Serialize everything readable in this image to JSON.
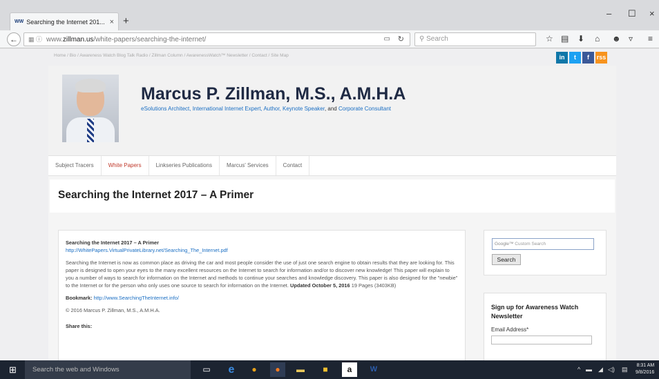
{
  "browser": {
    "tab_favicon": "WW",
    "tab_title": "Searching the Internet 201...",
    "tab_close": "×",
    "new_tab": "+",
    "url_prefix": "www.",
    "url_domain": "zillman.us",
    "url_path": "/white-papers/searching-the-internet/",
    "search_placeholder": "Search",
    "window_controls": {
      "minimize": "–",
      "maximize": "☐",
      "close": "×"
    },
    "toolbar_icons": [
      "star-icon",
      "clipboard-icon",
      "download-icon",
      "home-icon",
      "chat-icon",
      "pocket-icon",
      "menu-icon"
    ]
  },
  "site": {
    "topnav": "Home / Bio / Awareness Watch Blog Talk Radio / Zillman Column / AwarenessWatch™ Newsletter / Contact / Site Map",
    "social": [
      {
        "label": "in",
        "color": "#0e76a8"
      },
      {
        "label": "t",
        "color": "#1da1f2"
      },
      {
        "label": "f",
        "color": "#3b5998"
      },
      {
        "label": "rss",
        "color": "#f7931e"
      }
    ],
    "name": "Marcus P. Zillman, M.S., A.M.H.A",
    "tagline": {
      "part1": "eSolutions Architect, International Internet Expert, Author, ",
      "link1": "Keynote Speaker",
      "part2": ", and ",
      "link2": "Corporate Consultant"
    },
    "menu": [
      {
        "label": "Subject Tracers",
        "active": false
      },
      {
        "label": "White Papers",
        "active": true
      },
      {
        "label": "Linkseries Publications",
        "active": false
      },
      {
        "label": "Marcus' Services",
        "active": false
      },
      {
        "label": "Contact",
        "active": false
      }
    ]
  },
  "article": {
    "page_title": "Searching the Internet 2017 – A Primer",
    "title": "Searching the Internet 2017 – A Primer",
    "url": "http://WhitePapers.VirtualPrivateLibrary.net/Searching_The_Internet.pdf",
    "body": "Searching the Internet is now as common place as driving the car and most people consider the use of just one search engine to obtain results that they are looking for. This paper is designed to open your eyes to the many excellent resources on the Internet to search for information and/or to discover new knowledge! This paper will explain to you a number of ways to search for information on the Internet and methods to continue your searches and knowledge discovery. This paper is also designed for the \"newbie\" to the Internet or for the person who only uses one source to search for information on the Internet.",
    "updated": "Updated October 5, 2016",
    "pages": "19 Pages (3403KB)",
    "bookmark_label": "Bookmark:",
    "bookmark_url": "http://www.SearchingTheInternet.info/",
    "copyright": "© 2016 Marcus P. Zillman, M.S., A.M.H.A.",
    "share": "Share this:"
  },
  "sidebar": {
    "search_google": "Google™",
    "search_placeholder": "Custom Search",
    "search_button": "Search",
    "newsletter_title": "Sign up for Awareness Watch Newsletter",
    "email_label": "Email Address*"
  },
  "taskbar": {
    "search_placeholder": "Search the web and Windows",
    "apps": [
      "task-view-icon",
      "edge-icon",
      "chrome-icon",
      "firefox-icon",
      "file-explorer-icon",
      "store-icon",
      "amazon-icon",
      "word-icon"
    ],
    "time": "8:31 AM",
    "date": "9/8/2016"
  }
}
